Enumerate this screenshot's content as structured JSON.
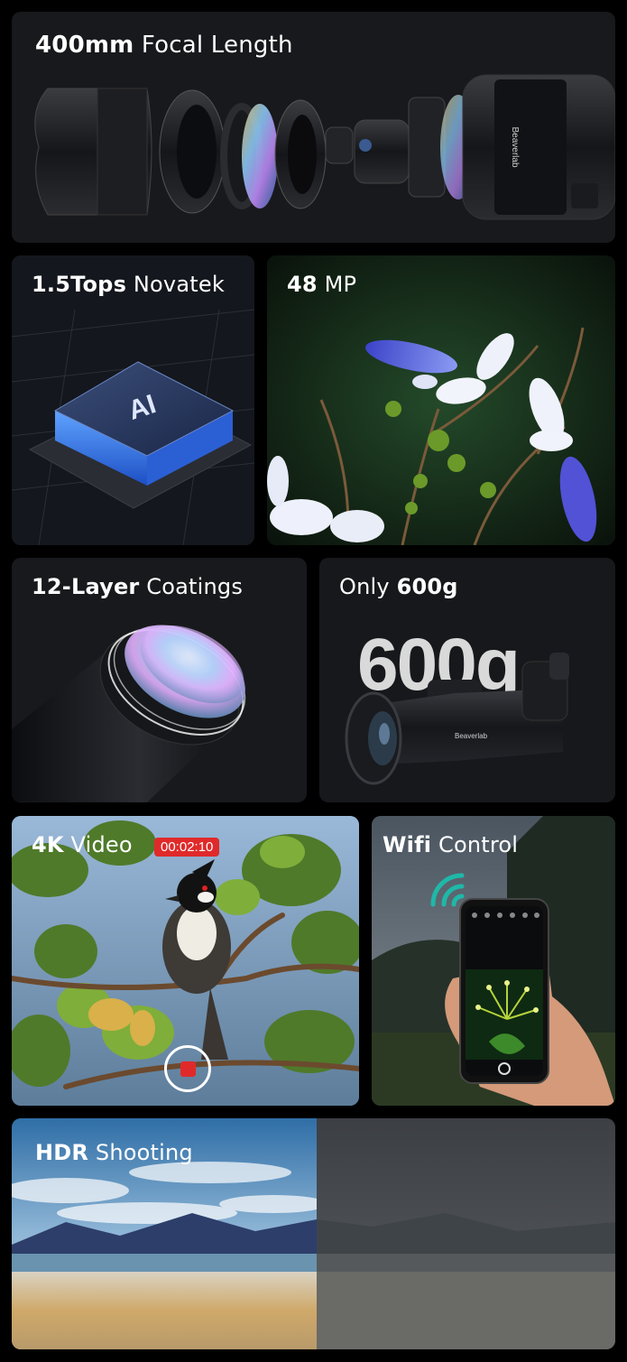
{
  "cards": {
    "focal": {
      "bold": "400mm",
      "light": " Focal Length",
      "brand": "Beaverlab"
    },
    "chip": {
      "bold": "1.5Tops",
      "light": " Novatek",
      "chip_label": "AI"
    },
    "mp": {
      "bold": "48",
      "light": " MP"
    },
    "coatings": {
      "bold": "12-Layer",
      "light": " Coatings"
    },
    "weight": {
      "light": "Only ",
      "bold": "600g",
      "big_text": "600g",
      "brand": "Beaverlab"
    },
    "video": {
      "bold": "4K",
      "light": " Video",
      "timer": "00:02:10"
    },
    "wifi": {
      "bold": "Wifi",
      "light": " Control"
    },
    "hdr": {
      "bold": "HDR",
      "light": " Shooting"
    }
  },
  "colors": {
    "card_bg": "#17181b",
    "rec_red": "#e02a2a",
    "wifi_teal": "#1fb8a8"
  },
  "icons": [
    "record-icon",
    "wifi-icon"
  ]
}
